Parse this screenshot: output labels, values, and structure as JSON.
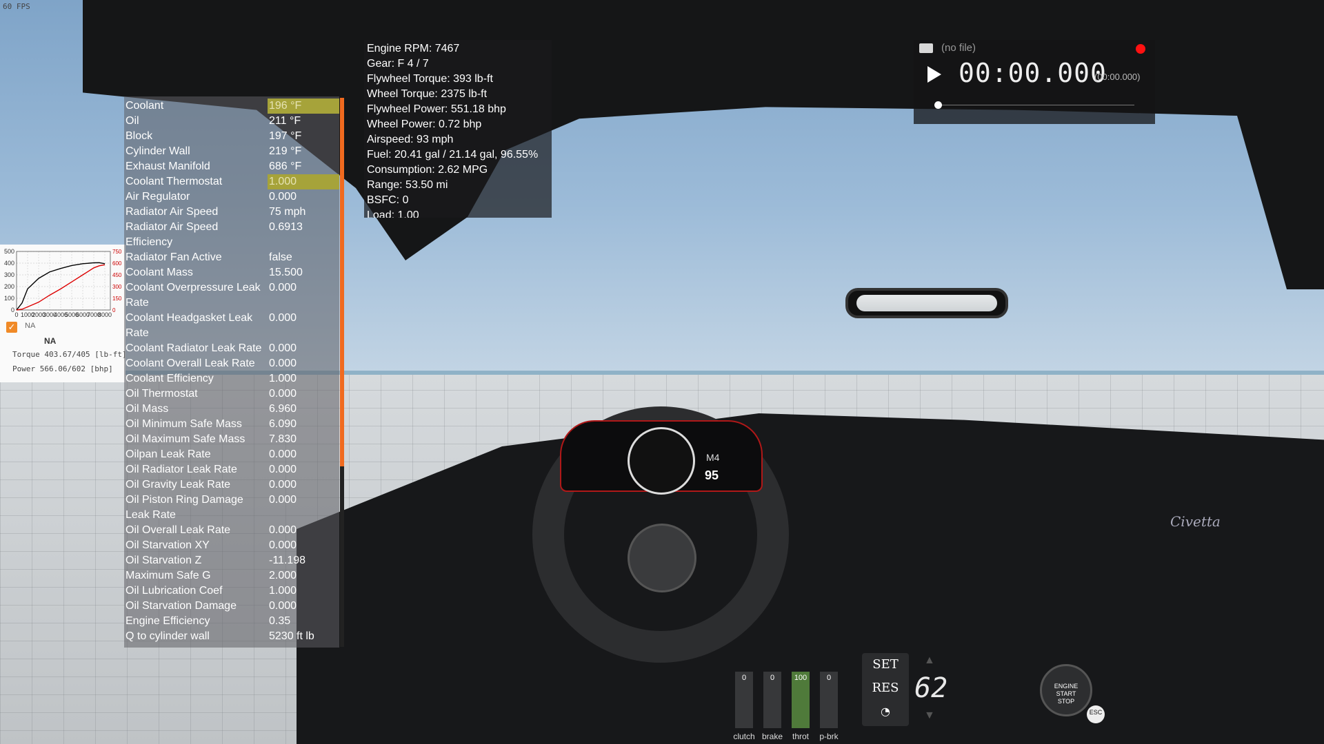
{
  "fps": "60 FPS",
  "debug_rows": [
    {
      "label": "Coolant",
      "value": "196 °F",
      "highlight": true
    },
    {
      "label": "Oil",
      "value": "211 °F"
    },
    {
      "label": "Block",
      "value": "197 °F"
    },
    {
      "label": "Cylinder Wall",
      "value": "219 °F"
    },
    {
      "label": "Exhaust Manifold",
      "value": "686 °F"
    },
    {
      "label": "Coolant Thermostat",
      "value": "1.000",
      "highlight": true
    },
    {
      "label": "Air Regulator",
      "value": "0.000"
    },
    {
      "label": "Radiator Air Speed",
      "value": "75 mph"
    },
    {
      "label": "Radiator Air Speed",
      "value": "0.6913"
    },
    {
      "label": "Efficiency",
      "value": ""
    },
    {
      "label": "Radiator Fan Active",
      "value": "false"
    },
    {
      "label": "Coolant Mass",
      "value": "15.500"
    },
    {
      "label": "Coolant Overpressure Leak",
      "value": "0.000"
    },
    {
      "label": "Rate",
      "value": ""
    },
    {
      "label": "Coolant Headgasket Leak",
      "value": "0.000"
    },
    {
      "label": "Rate",
      "value": ""
    },
    {
      "label": "Coolant Radiator Leak Rate",
      "value": "0.000"
    },
    {
      "label": "Coolant Overall Leak Rate",
      "value": "0.000"
    },
    {
      "label": "Coolant Efficiency",
      "value": "1.000"
    },
    {
      "label": "Oil Thermostat",
      "value": "0.000"
    },
    {
      "label": "Oil Mass",
      "value": "6.960"
    },
    {
      "label": "Oil Minimum Safe Mass",
      "value": "6.090"
    },
    {
      "label": "Oil Maximum Safe Mass",
      "value": "7.830"
    },
    {
      "label": "Oilpan Leak Rate",
      "value": "0.000"
    },
    {
      "label": "Oil Radiator Leak Rate",
      "value": "0.000"
    },
    {
      "label": "Oil Gravity Leak Rate",
      "value": "0.000"
    },
    {
      "label": "Oil Piston Ring Damage",
      "value": "0.000"
    },
    {
      "label": "Leak Rate",
      "value": ""
    },
    {
      "label": "Oil Overall Leak Rate",
      "value": "0.000"
    },
    {
      "label": "Oil Starvation XY",
      "value": "0.000"
    },
    {
      "label": "Oil Starvation Z",
      "value": "-11.198"
    },
    {
      "label": "Maximum Safe G",
      "value": "2.000"
    },
    {
      "label": "Oil Lubrication Coef",
      "value": "1.000"
    },
    {
      "label": "Oil Starvation Damage",
      "value": "0.000"
    },
    {
      "label": "Engine Efficiency",
      "value": "0.35"
    },
    {
      "label": "Q to cylinder wall",
      "value": "5230 ft lb"
    }
  ],
  "engine_info": [
    "Engine RPM: 7467",
    "Gear: F 4 / 7",
    "Flywheel Torque: 393 lb-ft",
    "Wheel Torque: 2375 lb-ft",
    "Flywheel Power: 551.18 bhp",
    "Wheel Power: 0.72 bhp",
    "Airspeed: 93 mph",
    "Fuel: 20.41 gal / 21.14 gal, 96.55%",
    "Consumption: 2.62 MPG",
    "Range: 53.50 mi",
    "BSFC: 0",
    "Load: 1.00"
  ],
  "recorder": {
    "file": "(no file)",
    "time": "00:00.000",
    "time_sub": "(00:00.000)"
  },
  "torque_graph": {
    "na_label": "NA",
    "title": "NA",
    "torque_text": "Torque 403.67/405 [lb-ft]",
    "power_text": "Power  566.06/602 [bhp]",
    "y_left_ticks": [
      "500",
      "400",
      "300",
      "200",
      "100",
      "0"
    ],
    "y_right_ticks": [
      "750",
      "600",
      "450",
      "300",
      "150",
      "0"
    ],
    "x_ticks": [
      "0",
      "1000",
      "2000",
      "3000",
      "4000",
      "5000",
      "6000",
      "7000",
      "8000"
    ]
  },
  "chart_data": {
    "type": "line",
    "x": [
      0,
      500,
      1000,
      2000,
      3000,
      4000,
      5000,
      6000,
      7000,
      7500,
      8000
    ],
    "series": [
      {
        "name": "Torque",
        "color": "#000000",
        "values": [
          0,
          60,
          180,
          270,
          325,
          355,
          380,
          395,
          403,
          404,
          395
        ]
      },
      {
        "name": "Power",
        "color": "#dd0000",
        "values": [
          0,
          10,
          40,
          100,
          190,
          270,
          360,
          450,
          540,
          566,
          580
        ]
      }
    ],
    "ylim": [
      0,
      500
    ],
    "y2lim": [
      0,
      750
    ],
    "xlim": [
      0,
      8500
    ]
  },
  "pedals": [
    {
      "label": "clutch",
      "value": "0",
      "fill": 0,
      "color": "#888888"
    },
    {
      "label": "brake",
      "value": "0",
      "fill": 0,
      "color": "#888888"
    },
    {
      "label": "throt",
      "value": "100",
      "fill": 1,
      "color": "#4f7a3a"
    },
    {
      "label": "p-brk",
      "value": "0",
      "fill": 0,
      "color": "#888888"
    }
  ],
  "cruise": {
    "set_label": "SET",
    "res_label": "RES",
    "speed": "62"
  },
  "start_button": {
    "line1": "ENGINE",
    "line2": "START",
    "line3": "STOP"
  },
  "esc_label": "ESC",
  "brand_text": "Civetta",
  "cluster": {
    "gear": "M4",
    "speed": "95"
  }
}
